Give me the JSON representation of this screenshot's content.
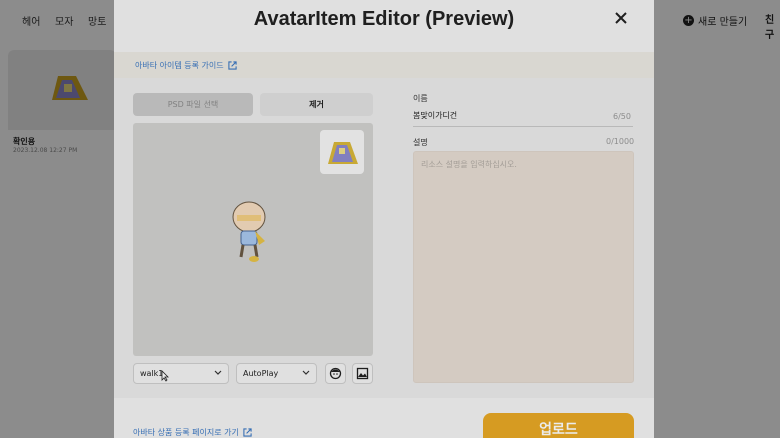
{
  "background": {
    "tabs": [
      "헤어",
      "모자",
      "망토"
    ],
    "card": {
      "title": "확인용",
      "date": "2023.12.08 12:27 PM"
    },
    "new_button": "새로 만들기",
    "right_tab": "친구"
  },
  "modal": {
    "title": "AvatarItem Editor (Preview)",
    "close_icon": "close-icon",
    "guide_link": "아바타 아이템 등록 가이드",
    "psd_button": "PSD 파일 선택",
    "remove_button": "제거",
    "action_select": {
      "value": "walk1"
    },
    "play_select": {
      "value": "AutoPlay"
    },
    "name": {
      "label": "이름",
      "value": "봄맞이가디건",
      "count": "6/50"
    },
    "description": {
      "label": "설명",
      "count": "0/1000",
      "placeholder": "리소스 설명을 입력하십시오.",
      "value": ""
    },
    "footer_link": "아바타 상품 등록 페이지로 가기",
    "upload_button": "업로드",
    "colors": {
      "accent": "#e9a925",
      "link": "#3b78c4"
    }
  }
}
